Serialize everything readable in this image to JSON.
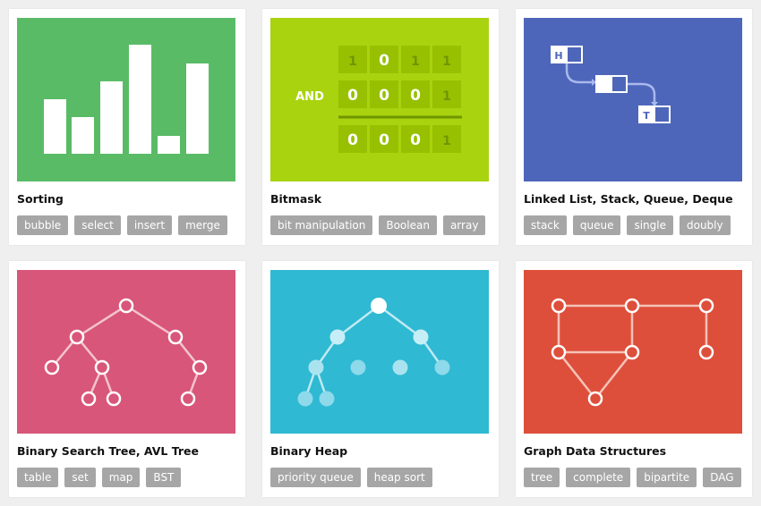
{
  "cards": [
    {
      "title": "Sorting",
      "color": "#5abb67",
      "tags": [
        "bubble",
        "select",
        "insert",
        "merge"
      ]
    },
    {
      "title": "Bitmask",
      "color": "#a9d30f",
      "tags": [
        "bit manipulation",
        "Boolean",
        "array"
      ],
      "bitmask": {
        "operator": "AND",
        "rows": [
          [
            "1",
            "0",
            "1",
            "1"
          ],
          [
            "0",
            "0",
            "0",
            "1"
          ],
          [
            "0",
            "0",
            "0",
            "1"
          ]
        ]
      }
    },
    {
      "title": "Linked List, Stack, Queue, Deque",
      "color": "#4e66b9",
      "tags": [
        "stack",
        "queue",
        "single",
        "doubly"
      ],
      "list": {
        "head": "H",
        "tail": "T"
      }
    },
    {
      "title": "Binary Search Tree, AVL Tree",
      "color": "#d85679",
      "tags": [
        "table",
        "set",
        "map",
        "BST"
      ]
    },
    {
      "title": "Binary Heap",
      "color": "#2fb9d3",
      "tags": [
        "priority queue",
        "heap sort"
      ]
    },
    {
      "title": "Graph Data Structures",
      "color": "#dd4f3b",
      "tags": [
        "tree",
        "complete",
        "bipartite",
        "DAG"
      ]
    }
  ]
}
